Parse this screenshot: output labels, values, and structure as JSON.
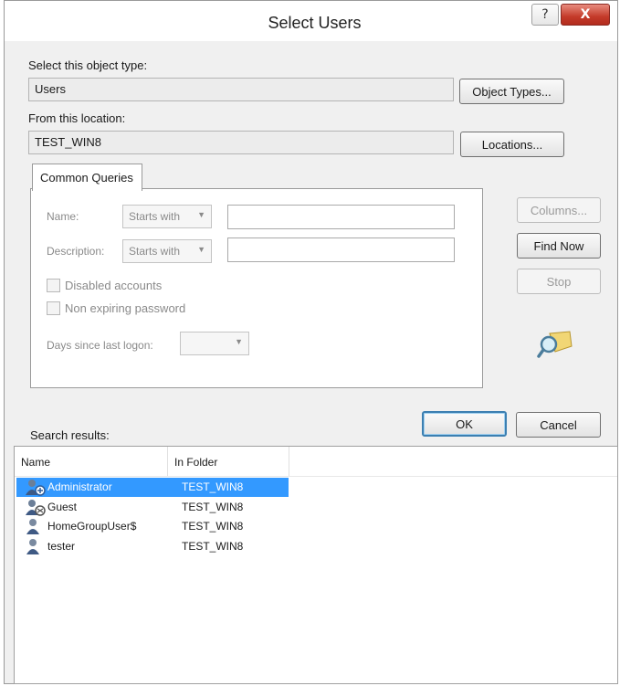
{
  "window": {
    "title": "Select Users",
    "help_glyph": "?",
    "close_glyph": "X"
  },
  "object_type": {
    "label": "Select this object type:",
    "value": "Users",
    "button": "Object Types..."
  },
  "location": {
    "label": "From this location:",
    "value": "TEST_WIN8",
    "button": "Locations..."
  },
  "common_queries": {
    "tab_label": "Common Queries",
    "name_label": "Name:",
    "name_mode": "Starts with",
    "name_value": "",
    "description_label": "Description:",
    "description_mode": "Starts with",
    "description_value": "",
    "disabled_accounts_label": "Disabled accounts",
    "non_expiring_label": "Non expiring password",
    "days_since_logon_label": "Days since last logon:",
    "days_since_logon_value": ""
  },
  "side_buttons": {
    "columns": "Columns...",
    "find_now": "Find Now",
    "stop": "Stop"
  },
  "dialog_buttons": {
    "ok": "OK",
    "cancel": "Cancel"
  },
  "results": {
    "label": "Search results:",
    "columns": [
      "Name",
      "In Folder"
    ],
    "rows": [
      {
        "name": "Administrator",
        "folder": "TEST_WIN8",
        "icon": "admin-user-icon",
        "selected": true
      },
      {
        "name": "Guest",
        "folder": "TEST_WIN8",
        "icon": "guest-user-icon",
        "selected": false
      },
      {
        "name": "HomeGroupUser$",
        "folder": "TEST_WIN8",
        "icon": "user-icon",
        "selected": false
      },
      {
        "name": "tester",
        "folder": "TEST_WIN8",
        "icon": "user-icon",
        "selected": false
      }
    ]
  },
  "colors": {
    "selection": "#3399ff",
    "close_button": "#c43b2a",
    "default_button_border": "#3c7fb1"
  }
}
